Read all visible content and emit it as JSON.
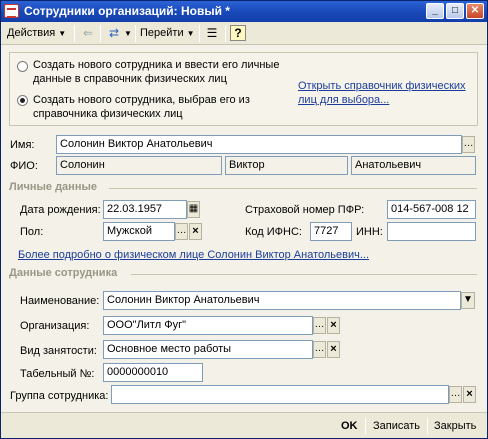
{
  "window": {
    "title": "Сотрудники организаций: Новый *"
  },
  "toolbar": {
    "actions_label": "Действия",
    "goto_label": "Перейти",
    "help_label": "?"
  },
  "choice": {
    "option1": "Создать нового сотрудника и ввести его личные данные в справочник физических лиц",
    "option2": "Создать нового сотрудника, выбрав его из справочника физических лиц",
    "open_directory_link": "Открыть справочник физических лиц для выбора...",
    "selected": 2
  },
  "name": {
    "label": "Имя:",
    "value": "Солонин Виктор  Анатольевич"
  },
  "fio": {
    "label": "ФИО:",
    "last": "Солонин",
    "first": "Виктор",
    "middle": "Анатольевич"
  },
  "personal": {
    "section_title": "Личные данные",
    "birth_date_label": "Дата рождения:",
    "birth_date": "22.03.1957",
    "pfr_label": "Страховой номер ПФР:",
    "pfr_value": "014-567-008 12",
    "sex_label": "Пол:",
    "sex_value": "Мужской",
    "ifns_label": "Код ИФНС:",
    "ifns_value": "7727",
    "inn_label": "ИНН:",
    "inn_value": "",
    "more_link": "Более подробно о физическом лице Солонин Виктор  Анатольевич..."
  },
  "employee": {
    "section_title": "Данные сотрудника",
    "name_label": "Наименование:",
    "name_value": "Солонин Виктор  Анатольевич",
    "org_label": "Организация:",
    "org_value": "ООО\"Литл Фуг\"",
    "employment_label": "Вид занятости:",
    "employment_value": "Основное место работы",
    "tabnum_label": "Табельный №:",
    "tabnum_value": "0000000010",
    "group_label": "Группа сотрудника:",
    "group_value": ""
  },
  "footer": {
    "ok": "OK",
    "save": "Записать",
    "close": "Закрыть"
  }
}
